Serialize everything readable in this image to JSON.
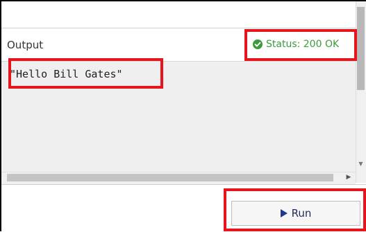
{
  "output": {
    "label": "Output",
    "text": "\"Hello Bill Gates\""
  },
  "status": {
    "text": "Status: 200 OK",
    "icon": "check-circle-icon",
    "color": "#3c9b3c"
  },
  "run_button": {
    "label": "Run",
    "icon": "play-icon",
    "icon_color": "#1e3a8a"
  },
  "highlights": {
    "color": "#e8141b",
    "targets": [
      "status",
      "output-text",
      "run-button"
    ]
  }
}
